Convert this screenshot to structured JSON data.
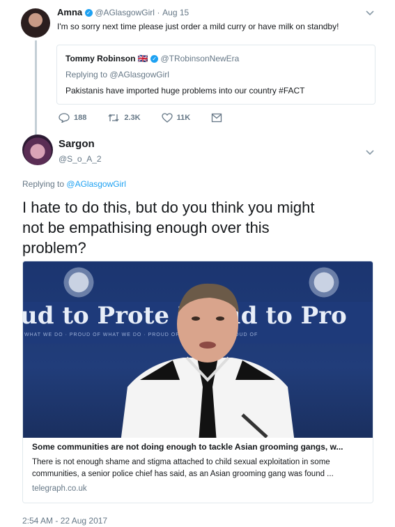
{
  "parent_tweet": {
    "name": "Amna",
    "handle": "@AGlasgowGirl",
    "separator": "·",
    "date": "Aug 15",
    "text": "I'm so sorry next time please just order a mild curry or have milk on standby!",
    "quote": {
      "name": "Tommy Robinson",
      "flag": "🇬🇧",
      "handle": "@TRobinsonNewEra",
      "reply_to": "Replying to @AGlasgowGirl",
      "text": "Pakistanis have imported huge problems into our country #FACT"
    },
    "actions": {
      "replies": "188",
      "retweets": "2.3K",
      "likes": "11K"
    }
  },
  "main_tweet": {
    "name": "Sargon",
    "handle": "@S_o_A_2",
    "reply_prefix": "Replying to",
    "reply_handle": "@AGlasgowGirl",
    "text_line1": "I hate to do this, but do you think you might",
    "text_line2": "not be empathising enough over this",
    "text_line3": "problem?",
    "card": {
      "banner_text": "ud to Prote   Proud to Pro",
      "banner_sub": "WHAT WE DO · PROUD OF WHAT WE DO · PROUD OF WHAT WE DO · PROUD OF",
      "title": "Some communities are not doing enough to tackle Asian grooming gangs, w...",
      "desc_line1": "There is not enough shame and stigma attached to child sexual exploitation in some",
      "desc_line2": "communities, a senior police chief has said, as an Asian grooming gang was found ...",
      "domain": "telegraph.co.uk"
    },
    "timestamp": "2:54 AM - 22 Aug 2017"
  },
  "icons": [
    "reply-icon",
    "retweet-icon",
    "like-icon",
    "dm-icon",
    "chevron-down-icon",
    "verified-icon"
  ],
  "colors": {
    "verified": "#1da1f2",
    "link": "#1da1f2",
    "muted": "#657786",
    "thread": "#c4cfd6"
  }
}
